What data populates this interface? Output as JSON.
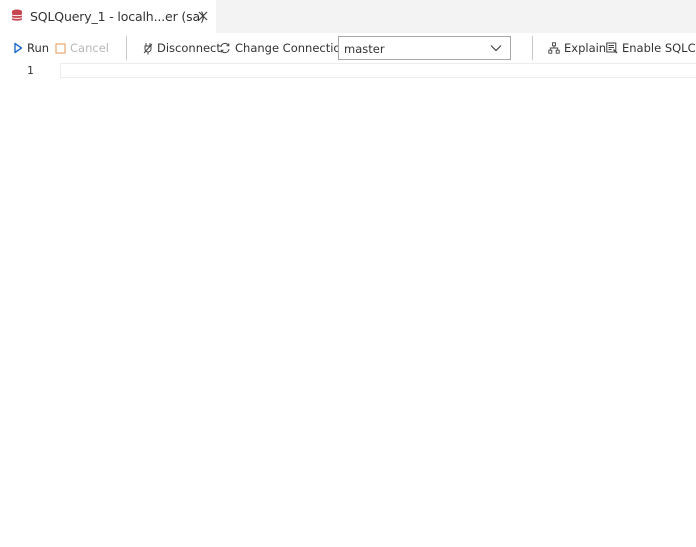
{
  "tab": {
    "title": "SQLQuery_1 - localh...er (sa)",
    "icon": "database-icon",
    "close_icon": "close-icon"
  },
  "toolbar": {
    "run_label": "Run",
    "cancel_label": "Cancel",
    "disconnect_label": "Disconnect",
    "change_connection_label": "Change Connection",
    "database": {
      "selected": "master"
    },
    "explain_label": "Explain",
    "sqlcmd_label": "Enable SQLCMD"
  },
  "editor": {
    "line_numbers": [
      "1"
    ]
  },
  "colors": {
    "tab_bar_bg": "#f3f3f3",
    "database_icon": "#c5464f",
    "run_icon": "#1e6bc9",
    "cancel_icon": "#e8a86b",
    "disabled_text": "#b8b8b8"
  }
}
